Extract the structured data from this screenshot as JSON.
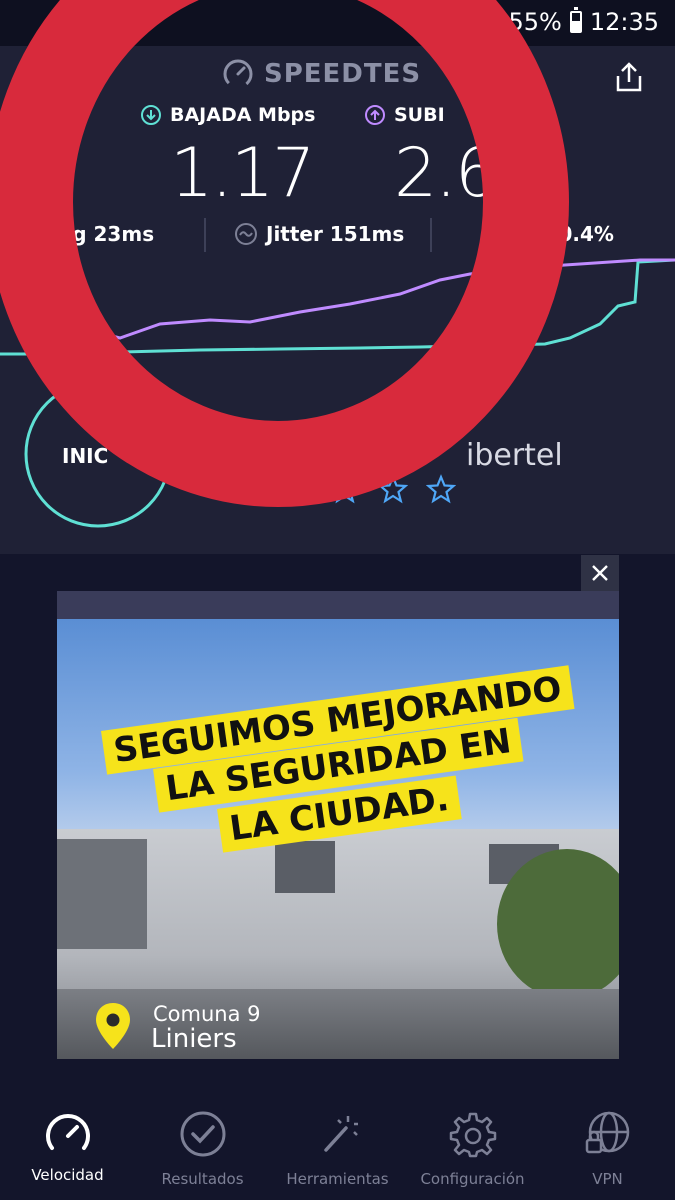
{
  "status": {
    "battery": "55%",
    "time": "12:35"
  },
  "header": {
    "brand": "SPEEDTES"
  },
  "download": {
    "label": "BAJADA Mbps",
    "value": "1.17"
  },
  "upload": {
    "label": "SUBI",
    "value": "2.6"
  },
  "stats": {
    "ping": "ng 23ms",
    "jitter": "Jitter 151ms",
    "loss": "a 0.4%"
  },
  "start": {
    "label": "INIC"
  },
  "isp": "ibertel",
  "ad": {
    "banner_line1": "SEGUIMOS MEJORANDO",
    "banner_line2": "LA SEGURIDAD EN",
    "banner_line3": "LA CIUDAD.",
    "location_line1": "Comuna 9",
    "location_line2": "Liniers"
  },
  "nav": [
    {
      "label": "Velocidad",
      "icon": "speedometer-icon",
      "active": true
    },
    {
      "label": "Resultados",
      "icon": "checkmark-circle-icon",
      "active": false
    },
    {
      "label": "Herramientas",
      "icon": "magic-wand-icon",
      "active": false
    },
    {
      "label": "Configuración",
      "icon": "gear-icon",
      "active": false
    },
    {
      "label": "VPN",
      "icon": "globe-lock-icon",
      "active": false
    }
  ],
  "colors": {
    "download": "#5fe0d4",
    "upload": "#bf8bff",
    "red_overlay": "#d82a3c",
    "banner_yellow": "#f6e31b",
    "background": "#13152b",
    "panel": "#1f2136"
  }
}
